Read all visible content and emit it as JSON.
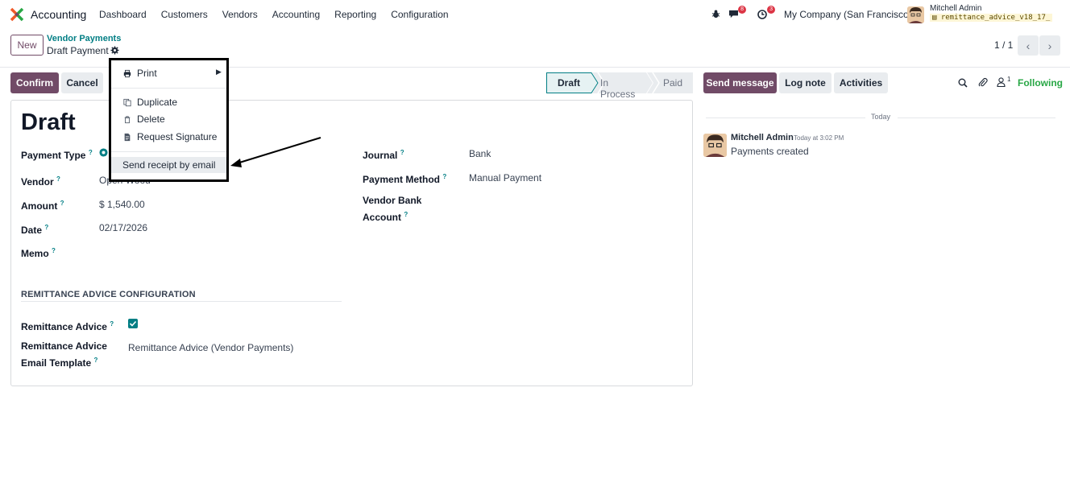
{
  "topnav": {
    "app_name": "Accounting",
    "menu": [
      "Dashboard",
      "Customers",
      "Vendors",
      "Accounting",
      "Reporting",
      "Configuration"
    ],
    "chat_count": "8",
    "activity_count": "3",
    "company": "My Company (San Francisco)",
    "user_name": "Mitchell Admin",
    "db_name": "remittance_advice_v18_17_"
  },
  "control": {
    "new_label": "New",
    "breadcrumb_parent": "Vendor Payments",
    "breadcrumb_current": "Draft Payment",
    "pager": "1 / 1"
  },
  "actions": {
    "confirm": "Confirm",
    "cancel": "Cancel"
  },
  "statusbar": {
    "stages": [
      "Draft",
      "In Process",
      "Paid"
    ],
    "active": "Draft"
  },
  "form": {
    "title": "Draft",
    "payment_type_label": "Payment Type",
    "vendor_label": "Vendor",
    "vendor_value": "Open Wood",
    "amount_label": "Amount",
    "amount_value": "$ 1,540.00",
    "date_label": "Date",
    "date_value": "02/17/2026",
    "memo_label": "Memo",
    "journal_label": "Journal",
    "journal_value": "Bank",
    "payment_method_label": "Payment Method",
    "payment_method_value": "Manual Payment",
    "vendor_bank_label_1": "Vendor Bank",
    "vendor_bank_label_2": "Account",
    "section_title": "REMITTANCE ADVICE CONFIGURATION",
    "remittance_advice_label": "Remittance Advice",
    "remittance_checked": true,
    "template_label_1": "Remittance Advice",
    "template_label_2": "Email Template",
    "template_value": "Remittance Advice (Vendor Payments)",
    "help_mark": "?"
  },
  "chatter": {
    "send_message": "Send message",
    "log_note": "Log note",
    "activities": "Activities",
    "follower_count": "1",
    "following": "Following",
    "day_label": "Today",
    "author": "Mitchell Admin",
    "time": "Today at 3:02 PM",
    "body": "Payments created"
  },
  "dropdown": {
    "print": "Print",
    "duplicate": "Duplicate",
    "delete": "Delete",
    "request_signature": "Request Signature",
    "send_receipt": "Send receipt by email"
  },
  "colors": {
    "brand": "#714b67",
    "teal": "#017e84",
    "following": "#28a745",
    "badge": "#dc3545"
  }
}
